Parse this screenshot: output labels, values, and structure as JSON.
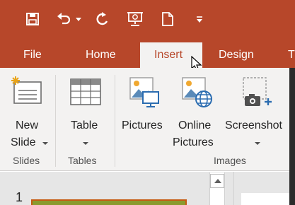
{
  "quick_access": {
    "icons": [
      "save-icon",
      "undo-icon",
      "undo-dropdown-icon",
      "redo-icon",
      "presentation-icon",
      "new-file-icon",
      "customize-icon"
    ]
  },
  "tabs": [
    {
      "label": "File"
    },
    {
      "label": "Home"
    },
    {
      "label": "Insert",
      "active": true
    },
    {
      "label": "Design"
    },
    {
      "label": "T"
    }
  ],
  "ribbon": {
    "slides_group": {
      "new_slide_line1": "New",
      "new_slide_line2": "Slide",
      "group_label": "Slides"
    },
    "tables_group": {
      "table_label": "Table",
      "group_label": "Tables"
    },
    "images_group": {
      "pictures_label": "Pictures",
      "online_pictures_line1": "Online",
      "online_pictures_line2": "Pictures",
      "screenshot_label": "Screenshot",
      "group_label": "Images"
    }
  },
  "slides_panel": {
    "slide_number": "1"
  },
  "colors": {
    "ribbon_accent": "#b7472a",
    "ribbon_bg": "#f3f2f1"
  }
}
